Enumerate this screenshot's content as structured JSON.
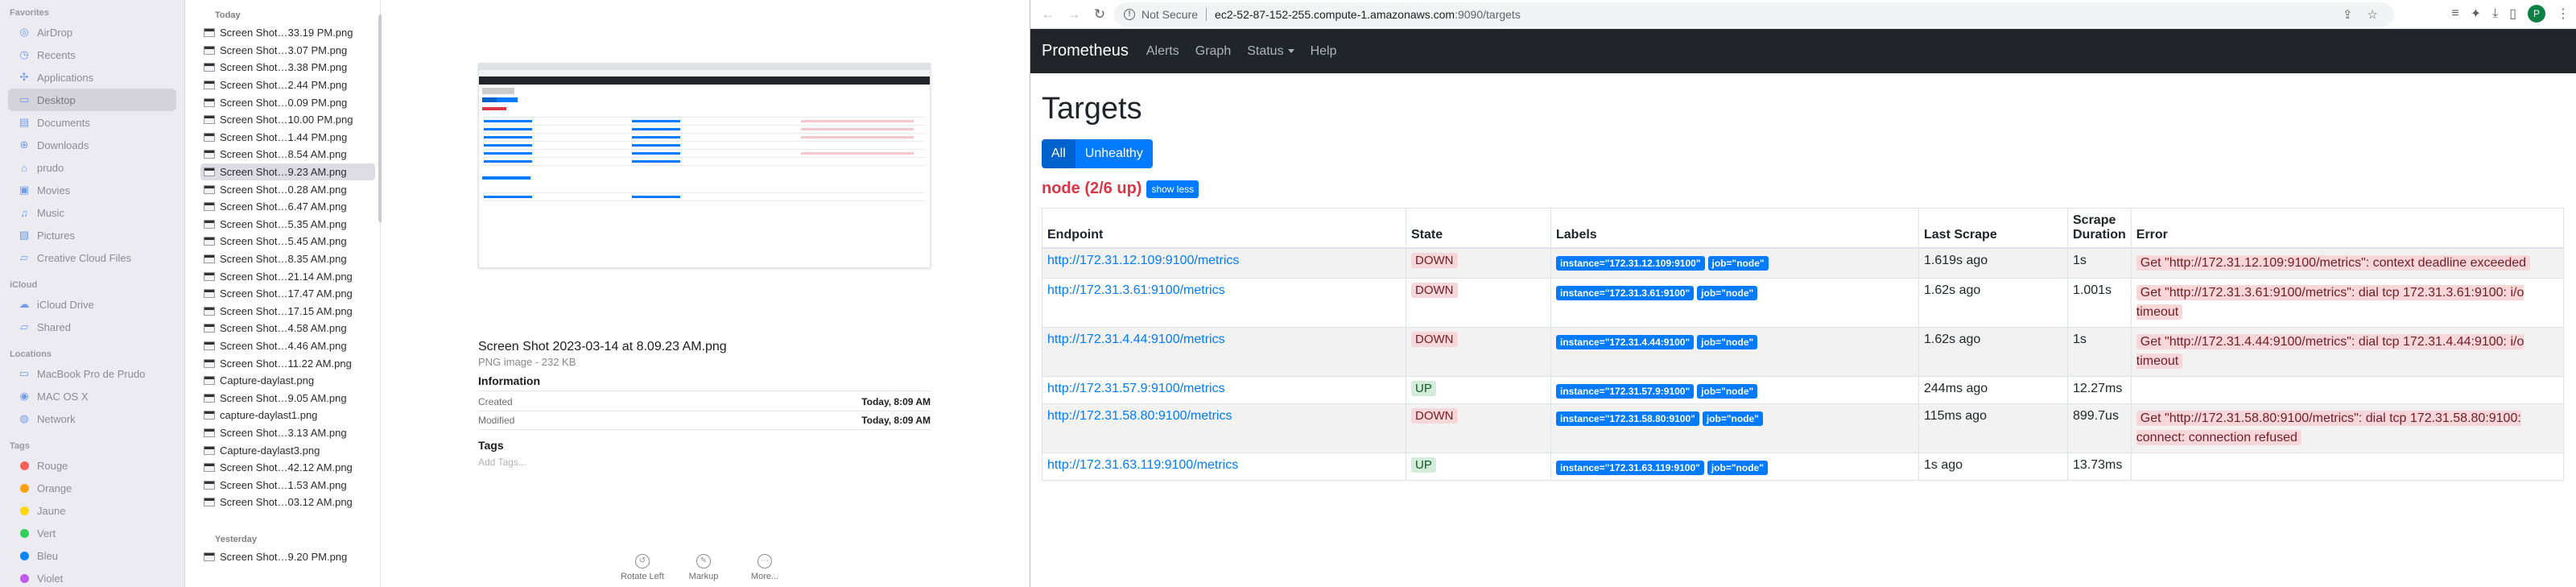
{
  "finder": {
    "sidebar": {
      "sections": [
        {
          "title": "Favorites",
          "items": [
            {
              "label": "AirDrop",
              "icon": "airdrop-icon"
            },
            {
              "label": "Recents",
              "icon": "clock-icon"
            },
            {
              "label": "Applications",
              "icon": "applications-icon"
            },
            {
              "label": "Desktop",
              "icon": "desktop-icon",
              "selected": true
            },
            {
              "label": "Documents",
              "icon": "document-icon"
            },
            {
              "label": "Downloads",
              "icon": "download-icon"
            },
            {
              "label": "prudo",
              "icon": "home-icon"
            },
            {
              "label": "Movies",
              "icon": "film-icon"
            },
            {
              "label": "Music",
              "icon": "music-icon"
            },
            {
              "label": "Pictures",
              "icon": "photo-icon"
            },
            {
              "label": "Creative Cloud Files",
              "icon": "folder-icon"
            }
          ]
        },
        {
          "title": "iCloud",
          "items": [
            {
              "label": "iCloud Drive",
              "icon": "cloud-icon"
            },
            {
              "label": "Shared",
              "icon": "shared-folder-icon"
            }
          ]
        },
        {
          "title": "Locations",
          "items": [
            {
              "label": "MacBook Pro de Prudo",
              "icon": "laptop-icon"
            },
            {
              "label": "MAC OS X",
              "icon": "disk-icon"
            },
            {
              "label": "Network",
              "icon": "network-icon"
            }
          ]
        },
        {
          "title": "Tags",
          "items": [
            {
              "label": "Rouge",
              "color": "#ff5f57"
            },
            {
              "label": "Orange",
              "color": "#ff9f0a"
            },
            {
              "label": "Jaune",
              "color": "#ffd60a"
            },
            {
              "label": "Vert",
              "color": "#30d158"
            },
            {
              "label": "Bleu",
              "color": "#0a84ff"
            },
            {
              "label": "Violet",
              "color": "#bf5af2"
            }
          ]
        }
      ]
    },
    "filelist": {
      "group_today": "Today",
      "files": [
        "Screen Shot…33.19 PM.png",
        "Screen Shot…3.07 PM.png",
        "Screen Shot…3.38 PM.png",
        "Screen Shot…2.44 PM.png",
        "Screen Shot…0.09 PM.png",
        "Screen Shot…10.00 PM.png",
        "Screen Shot…1.44 PM.png",
        "Screen Shot…8.54 AM.png",
        "Screen Shot…9.23 AM.png",
        "Screen Shot…0.28 AM.png",
        "Screen Shot…6.47 AM.png",
        "Screen Shot…5.35 AM.png",
        "Screen Shot…5.45 AM.png",
        "Screen Shot…8.35 AM.png",
        "Screen Shot…21.14 AM.png",
        "Screen Shot…17.47 AM.png",
        "Screen Shot…17.15 AM.png",
        "Screen Shot…4.58 AM.png",
        "Screen Shot…4.46 AM.png",
        "Screen Shot…11.22 AM.png",
        "Capture-daylast.png",
        "Screen Shot…9.05 AM.png",
        "capture-daylast1.png",
        "Screen Shot…3.13 AM.png",
        "Capture-daylast3.png",
        "Screen Shot…42.12 AM.png",
        "Screen Shot…1.53 AM.png",
        "Screen Shot…03.12 AM.png"
      ],
      "selected_index": 8,
      "group_yesterday": "Yesterday",
      "yesterday_files": [
        "Screen Shot…9.20 PM.png"
      ]
    },
    "preview": {
      "filename": "Screen Shot 2023-03-14 at 8.09.23 AM.png",
      "type": "PNG image - 232 KB",
      "info_title": "Information",
      "created_label": "Created",
      "created_value": "Today, 8:09 AM",
      "modified_label": "Modified",
      "modified_value": "Today, 8:09 AM",
      "tags_title": "Tags",
      "tags_placeholder": "Add Tags...",
      "actions": [
        {
          "label": "Rotate Left",
          "icon": "rotate-left-icon"
        },
        {
          "label": "Markup",
          "icon": "markup-icon"
        },
        {
          "label": "More...",
          "icon": "more-icon"
        }
      ]
    }
  },
  "browser": {
    "security_label": "Not Secure",
    "url_host": "ec2-52-87-152-255.compute-1.amazonaws.com",
    "url_path": ":9090/targets",
    "avatar_letter": "P"
  },
  "prometheus": {
    "brand": "Prometheus",
    "nav": [
      "Alerts",
      "Graph",
      "Status",
      "Help"
    ],
    "page_title": "Targets",
    "filter_buttons": [
      "All",
      "Unhealthy"
    ],
    "job_title": "node (2/6 up)",
    "show_less": "show less",
    "columns": [
      "Endpoint",
      "State",
      "Labels",
      "Last Scrape",
      "Scrape Duration",
      "Error"
    ],
    "targets": [
      {
        "endpoint": "http://172.31.12.109:9100/metrics",
        "state": "DOWN",
        "labels": [
          "instance=\"172.31.12.109:9100\"",
          "job=\"node\""
        ],
        "last_scrape": "1.619s ago",
        "duration": "1s",
        "error": "Get \"http://172.31.12.109:9100/metrics\": context deadline exceeded"
      },
      {
        "endpoint": "http://172.31.3.61:9100/metrics",
        "state": "DOWN",
        "labels": [
          "instance=\"172.31.3.61:9100\"",
          "job=\"node\""
        ],
        "last_scrape": "1.62s ago",
        "duration": "1.001s",
        "error": "Get \"http://172.31.3.61:9100/metrics\": dial tcp 172.31.3.61:9100: i/o timeout"
      },
      {
        "endpoint": "http://172.31.4.44:9100/metrics",
        "state": "DOWN",
        "labels": [
          "instance=\"172.31.4.44:9100\"",
          "job=\"node\""
        ],
        "last_scrape": "1.62s ago",
        "duration": "1s",
        "error": "Get \"http://172.31.4.44:9100/metrics\": dial tcp 172.31.4.44:9100: i/o timeout"
      },
      {
        "endpoint": "http://172.31.57.9:9100/metrics",
        "state": "UP",
        "labels": [
          "instance=\"172.31.57.9:9100\"",
          "job=\"node\""
        ],
        "last_scrape": "244ms ago",
        "duration": "12.27ms",
        "error": ""
      },
      {
        "endpoint": "http://172.31.58.80:9100/metrics",
        "state": "DOWN",
        "labels": [
          "instance=\"172.31.58.80:9100\"",
          "job=\"node\""
        ],
        "last_scrape": "115ms ago",
        "duration": "899.7us",
        "error": "Get \"http://172.31.58.80:9100/metrics\": dial tcp 172.31.58.80:9100: connect: connection refused"
      },
      {
        "endpoint": "http://172.31.63.119:9100/metrics",
        "state": "UP",
        "labels": [
          "instance=\"172.31.63.119:9100\"",
          "job=\"node\""
        ],
        "last_scrape": "1s ago",
        "duration": "13.73ms",
        "error": ""
      }
    ]
  }
}
